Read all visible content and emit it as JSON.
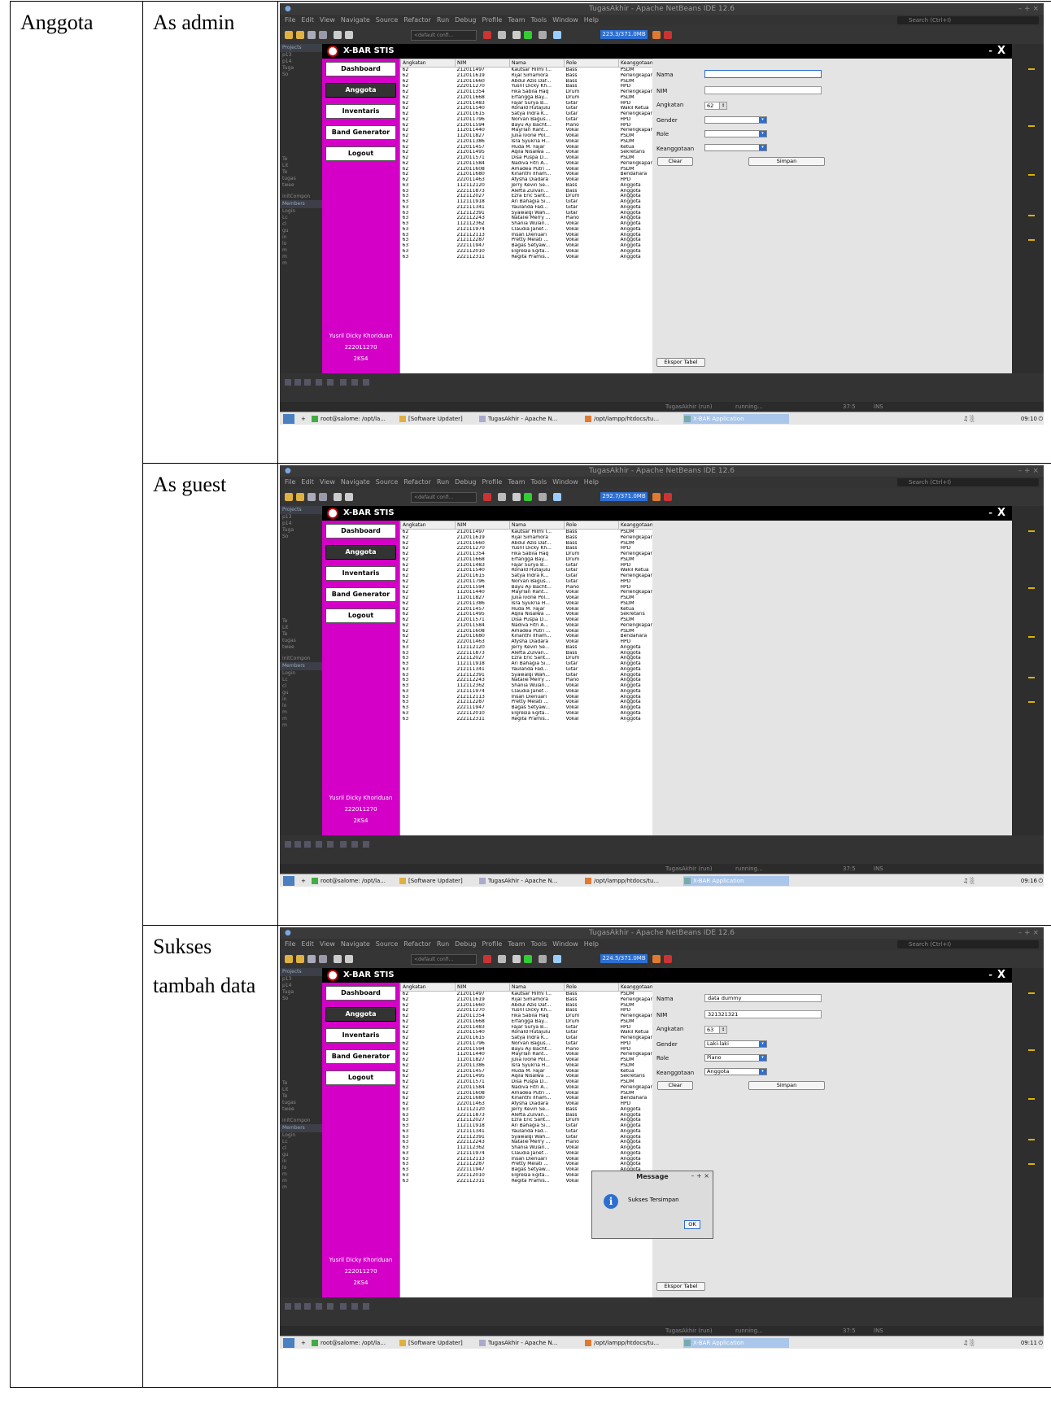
{
  "labels": {
    "section": "Anggota",
    "admin": "As admin",
    "guest": "As guest",
    "success": "Sukses tambah data"
  },
  "ide": {
    "title": "TugasAkhir - Apache NetBeans IDE 12.6",
    "menu": [
      "File",
      "Edit",
      "View",
      "Navigate",
      "Source",
      "Refactor",
      "Run",
      "Debug",
      "Profile",
      "Team",
      "Tools",
      "Window",
      "Help"
    ],
    "search_placeholder": "Search (Ctrl+I)",
    "config": "<default confi...",
    "left_tab": "Projects",
    "left_lines": [
      "p13",
      "p14",
      "Tuga",
      "So",
      "",
      "",
      "",
      "",
      "",
      "",
      "",
      "",
      "",
      "",
      "",
      "",
      "Te",
      "Lit",
      "Te",
      "tugas",
      "twee"
    ],
    "init_label": "initCompon",
    "members_tab": "Members",
    "member_lines": [
      "Login",
      "Lc",
      "cl",
      "gu",
      "in",
      "lo",
      "m",
      "m",
      "m"
    ],
    "run_status": "TugasAkhir (run)",
    "running": "running...",
    "pos": "37:5",
    "ins": "INS"
  },
  "app": {
    "title": "X-BAR STIS",
    "close": "X",
    "minimize": "-",
    "nav": [
      "Dashboard",
      "Anggota",
      "Inventaris",
      "Band Generator",
      "Logout"
    ],
    "user_name": "Yusril Dicky Khoriduan",
    "user_nim": "222011270",
    "user_class": "2KS4"
  },
  "table": {
    "headers": [
      "Angkatan",
      "NIM",
      "Nama",
      "Role",
      "Keanggotaan"
    ],
    "rows": [
      [
        "62",
        "212011497",
        "Kautsar Hilmi I...",
        "Bass",
        "PSDM"
      ],
      [
        "62",
        "212011619",
        "Rijal Simamora",
        "Bass",
        "Perlengkapan"
      ],
      [
        "62",
        "212011660",
        "Abdul Azis Daf...",
        "Bass",
        "PSDM"
      ],
      [
        "62",
        "222011270",
        "Yusril Dicky Kh...",
        "Bass",
        "HPD"
      ],
      [
        "62",
        "212011354",
        "Fika Sabila Haq",
        "Drum",
        "Perlengkapan"
      ],
      [
        "62",
        "212011668",
        "Erfangga Bay...",
        "Drum",
        "PSDM"
      ],
      [
        "62",
        "212011483",
        "Fajar Surya B...",
        "Gitar",
        "HPD"
      ],
      [
        "62",
        "212011540",
        "Ronald Hutajulu",
        "Gitar",
        "Wakil Ketua"
      ],
      [
        "62",
        "212011615",
        "Satya Indra K...",
        "Gitar",
        "Perlengkapan"
      ],
      [
        "62",
        "212011796",
        "Norvan Bagus...",
        "Gitar",
        "HPD"
      ],
      [
        "62",
        "212011594",
        "Bayu Aji Bacht...",
        "Piano",
        "HPD"
      ],
      [
        "62",
        "112011440",
        "Mayrlan Rant...",
        "Vokal",
        "Perlengkapan"
      ],
      [
        "62",
        "112011827",
        "Julia Ivone Pol...",
        "Vokal",
        "PSDM"
      ],
      [
        "62",
        "212011386",
        "Isra Syukria H...",
        "Vokal",
        "PSDM"
      ],
      [
        "62",
        "212011457",
        "Huda M. Fajar",
        "Vokal",
        "Ketua"
      ],
      [
        "62",
        "212011495",
        "Aqila Nisalwa ...",
        "Vokal",
        "Sekretaris"
      ],
      [
        "62",
        "212011571",
        "Disa Puspa D...",
        "Vokal",
        "PSDM"
      ],
      [
        "62",
        "212011584",
        "Nadiva Fitri A...",
        "Vokal",
        "Perlengkapan"
      ],
      [
        "62",
        "212011608",
        "Amadea Putri ...",
        "Vokal",
        "PSDM"
      ],
      [
        "62",
        "212011680",
        "Kinanthi Ilham...",
        "Vokal",
        "Bendahara"
      ],
      [
        "62",
        "222011463",
        "Afysha Diadara",
        "Vokal",
        "HPD"
      ],
      [
        "63",
        "112112120",
        "Jerry Kevin Se...",
        "Bass",
        "Anggota"
      ],
      [
        "63",
        "222111873",
        "Alefta Zulvan...",
        "Bass",
        "Anggota"
      ],
      [
        "63",
        "212112027",
        "Ezra Eric Sant...",
        "Drum",
        "Anggota"
      ],
      [
        "63",
        "112111918",
        "Ari Bahagia Si...",
        "Gitar",
        "Anggota"
      ],
      [
        "63",
        "212111341",
        "Yaulanda Fad...",
        "Gitar",
        "Anggota"
      ],
      [
        "63",
        "212112391",
        "Syawalgi Wah...",
        "Gitar",
        "Anggota"
      ],
      [
        "63",
        "222112243",
        "Natalie Merry ...",
        "Piano",
        "Anggota"
      ],
      [
        "63",
        "112112362",
        "Shania Wulan...",
        "Vokal",
        "Anggota"
      ],
      [
        "63",
        "212111974",
        "Claudia Janef...",
        "Vokal",
        "Anggota"
      ],
      [
        "63",
        "212112113",
        "Insan Dienuari",
        "Vokal",
        "Anggota"
      ],
      [
        "63",
        "212112287",
        "Pretty Melati ...",
        "Vokal",
        "Anggota"
      ],
      [
        "63",
        "222111947",
        "Bagas Setyaw...",
        "Vokal",
        "Anggota"
      ],
      [
        "63",
        "222112010",
        "Elgresia Egita...",
        "Vokal",
        "Anggota"
      ],
      [
        "63",
        "222112311",
        "Regita Pramis...",
        "Vokal",
        "Anggota"
      ]
    ]
  },
  "form": {
    "labels": {
      "nama": "Nama",
      "nim": "NIM",
      "angkatan": "Angkatan",
      "gender": "Gender",
      "role": "Role",
      "keanggotaan": "Keanggotaan"
    },
    "clear": "Clear",
    "simpan": "Simpan",
    "ekspor": "Ekspor Tabel"
  },
  "shots": {
    "admin": {
      "mem": "223.3/371.0MB",
      "clock": "09:10",
      "nama": "",
      "nim": "",
      "angkatan": "62",
      "gender": "",
      "role": "",
      "keanggotaan": ""
    },
    "guest": {
      "mem": "292.7/371.0MB",
      "clock": "09:16"
    },
    "success": {
      "mem": "224.5/371.0MB",
      "clock": "09:11",
      "nama": "data dummy",
      "nim": "321321321",
      "angkatan": "63",
      "gender": "Laki-laki",
      "role": "Piano",
      "keanggotaan": "Anggota"
    }
  },
  "dialog": {
    "title": "Message",
    "text": "Sukses Tersimpan",
    "ok": "OK"
  },
  "taskbar": {
    "plus": "+",
    "items": [
      "root@salome: /opt/la...",
      "[Software Updater]",
      "TugasAkhir - Apache N...",
      "/opt/lampp/htdocs/tu...",
      "X-BAR Application"
    ]
  },
  "colors": {
    "sidebar": "#d400c8",
    "accent": "#2d6fd1",
    "header": "#000000"
  }
}
